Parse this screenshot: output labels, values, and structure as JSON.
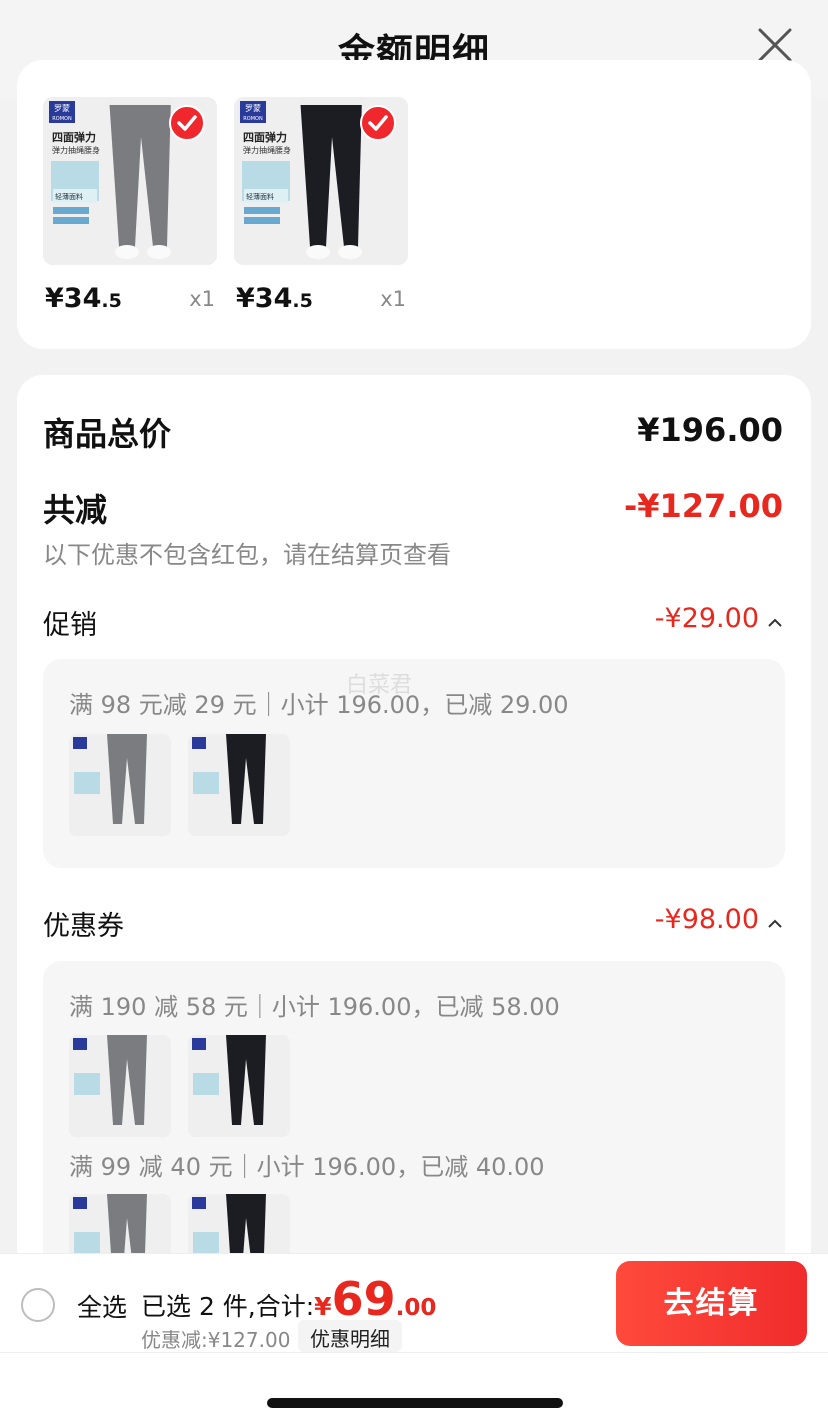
{
  "header": {
    "title": "金额明细",
    "close_icon": "close-icon"
  },
  "products": [
    {
      "color": "#7a7c80",
      "price_int": "¥34",
      "price_dec": ".5",
      "qty": "x1",
      "selected": true
    },
    {
      "color": "#1c1d22",
      "price_int": "¥34",
      "price_dec": ".5",
      "qty": "x1",
      "selected": true
    }
  ],
  "product_image_text": {
    "brand": "罗蒙",
    "brand_en": "ROMON",
    "headline": "四面弹力",
    "sub": "弹力抽绳腰身",
    "fabric": "轻薄面料"
  },
  "summary": {
    "total_label": "商品总价",
    "total_amount": "¥196.00",
    "discount_label": "共减",
    "discount_amount": "-¥127.00",
    "note": "以下优惠不包含红包，请在结算页查看"
  },
  "promotion": {
    "label": "促销",
    "amount": "-¥29.00",
    "rules": [
      "满 98 元减 29 元｜小计 196.00，已减 29.00"
    ]
  },
  "coupon": {
    "label": "优惠券",
    "amount": "-¥98.00",
    "rules": [
      "满 190 减 58 元｜小计 196.00，已减 58.00",
      "满 99 减 40 元｜小计 196.00，已减 40.00"
    ]
  },
  "watermark": "白菜君",
  "bottom_bar": {
    "select_all": "全选",
    "selected_text": "已选 2 件,合计:",
    "total_symbol": "¥",
    "total_int": "69",
    "total_dec": ".00",
    "discount_text": "优惠减:¥127.00",
    "detail_link": "优惠明细",
    "checkout": "去结算"
  },
  "colors": {
    "accent": "#e8281e",
    "checkout": "#f02c2c"
  }
}
